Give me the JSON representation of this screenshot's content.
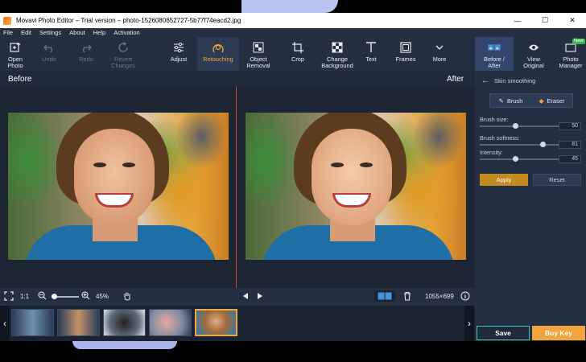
{
  "window": {
    "title": "Movavi Photo Editor – Trial version – photo-1526080652727-5b77f74eacd2.jpg",
    "minimize": "—",
    "maximize": "☐",
    "close": "✕"
  },
  "menu": [
    "File",
    "Edit",
    "Settings",
    "About",
    "Help",
    "Activation"
  ],
  "toolbar": {
    "open_photo": [
      "Open",
      "Photo"
    ],
    "undo": "Undo",
    "redo": "Redo",
    "revert": [
      "Revert",
      "Changes"
    ],
    "adjust": "Adjust",
    "retouching": "Retouching",
    "object_removal": [
      "Object",
      "Removal"
    ],
    "crop": "Crop",
    "change_background": [
      "Change",
      "Background"
    ],
    "text": "Text",
    "frames": "Frames",
    "more": "More",
    "before_after": [
      "Before /",
      "After"
    ],
    "view_original": [
      "View",
      "Original"
    ],
    "photo_manager": [
      "Photo",
      "Manager"
    ],
    "new_badge": "New"
  },
  "compare": {
    "before": "Before",
    "after": "After"
  },
  "controls": {
    "zoom_ratio": "1:1",
    "zoom_percent": "45%",
    "zoom_level": 0.1,
    "dimensions": "1055×699"
  },
  "panel": {
    "title": "Skin smoothing",
    "brush": "Brush",
    "eraser": "Eraser",
    "brush_size_label": "Brush size:",
    "brush_size_value": "50",
    "brush_size_fraction": 0.45,
    "brush_softness_label": "Brush softness:",
    "brush_softness_value": "81",
    "brush_softness_fraction": 0.8,
    "intensity_label": "Intensity:",
    "intensity_value": "45",
    "intensity_fraction": 0.45,
    "apply": "Apply",
    "reset": "Reset"
  },
  "footer": {
    "save": "Save",
    "buy": "Buy Key"
  },
  "colors": {
    "accent": "#f2a53c",
    "panel": "#243042",
    "divider": "#e2453d"
  }
}
